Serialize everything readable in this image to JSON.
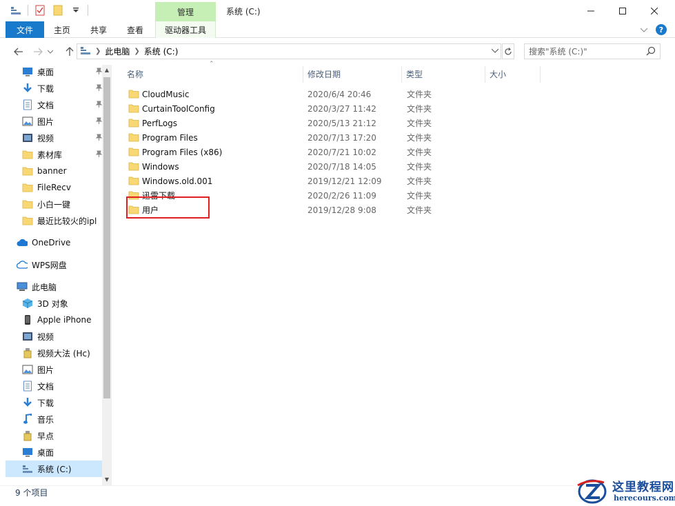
{
  "titlebar": {
    "context_tab": "管理",
    "title": "系统 (C:)"
  },
  "ribbon": {
    "tabs": [
      "文件",
      "主页",
      "共享",
      "查看",
      "驱动器工具"
    ]
  },
  "address": {
    "crumbs": [
      "此电脑",
      "系统 (C:)"
    ],
    "search_placeholder": "搜索\"系统 (C:)\""
  },
  "sidebar": {
    "items": [
      {
        "label": "桌面",
        "icon": "desktop-icon",
        "pinned": true
      },
      {
        "label": "下载",
        "icon": "download-icon",
        "pinned": true
      },
      {
        "label": "文档",
        "icon": "document-icon",
        "pinned": true
      },
      {
        "label": "图片",
        "icon": "picture-icon",
        "pinned": true
      },
      {
        "label": "视频",
        "icon": "video-icon",
        "pinned": true
      },
      {
        "label": "素材库",
        "icon": "folder-icon",
        "pinned": true
      },
      {
        "label": "banner",
        "icon": "folder-icon",
        "pinned": false
      },
      {
        "label": "FileRecv",
        "icon": "folder-icon",
        "pinned": false
      },
      {
        "label": "小白一键",
        "icon": "folder-icon",
        "pinned": false
      },
      {
        "label": "最近比较火的ipl",
        "icon": "folder-icon",
        "pinned": false
      },
      {
        "label": "OneDrive",
        "icon": "cloud-icon",
        "pinned": false
      },
      {
        "label": "WPS网盘",
        "icon": "cloud-outline-icon",
        "pinned": false
      },
      {
        "label": "此电脑",
        "icon": "computer-icon",
        "pinned": false
      },
      {
        "label": "3D 对象",
        "icon": "cube-icon",
        "pinned": false
      },
      {
        "label": "Apple iPhone",
        "icon": "phone-icon",
        "pinned": false
      },
      {
        "label": "视频",
        "icon": "video-icon",
        "pinned": false
      },
      {
        "label": "视频大法 (Hc)",
        "icon": "usb-drive-icon",
        "pinned": false
      },
      {
        "label": "图片",
        "icon": "picture-icon",
        "pinned": false
      },
      {
        "label": "文档",
        "icon": "document-icon",
        "pinned": false
      },
      {
        "label": "下载",
        "icon": "download-icon",
        "pinned": false
      },
      {
        "label": "音乐",
        "icon": "music-icon",
        "pinned": false
      },
      {
        "label": "早点",
        "icon": "usb-drive-icon",
        "pinned": false
      },
      {
        "label": "桌面",
        "icon": "desktop-icon",
        "pinned": false
      },
      {
        "label": "系统 (C:)",
        "icon": "drive-icon",
        "pinned": false,
        "selected": true
      }
    ]
  },
  "columns": {
    "name": "名称",
    "date": "修改日期",
    "type": "类型",
    "size": "大小"
  },
  "files": [
    {
      "name": "CloudMusic",
      "date": "2020/6/4 20:46",
      "type": "文件夹"
    },
    {
      "name": "CurtainToolConfig",
      "date": "2020/3/27 11:42",
      "type": "文件夹"
    },
    {
      "name": "PerfLogs",
      "date": "2020/5/13 21:12",
      "type": "文件夹"
    },
    {
      "name": "Program Files",
      "date": "2020/7/13 17:20",
      "type": "文件夹"
    },
    {
      "name": "Program Files (x86)",
      "date": "2020/7/21 10:02",
      "type": "文件夹"
    },
    {
      "name": "Windows",
      "date": "2020/7/18 14:05",
      "type": "文件夹"
    },
    {
      "name": "Windows.old.001",
      "date": "2019/12/21 12:09",
      "type": "文件夹"
    },
    {
      "name": "迅雷下载",
      "date": "2020/2/26 11:09",
      "type": "文件夹"
    },
    {
      "name": "用户",
      "date": "2019/12/28 9:08",
      "type": "文件夹"
    }
  ],
  "status": {
    "count": "9 个项目"
  },
  "watermark": {
    "cn": "这里教程网",
    "en": "herecours.com"
  },
  "colors": {
    "accent": "#1979ca",
    "context_tab": "#c6efb5",
    "selection": "#cce8ff",
    "folder": "#f8d775",
    "highlight_box": "#e02020"
  }
}
